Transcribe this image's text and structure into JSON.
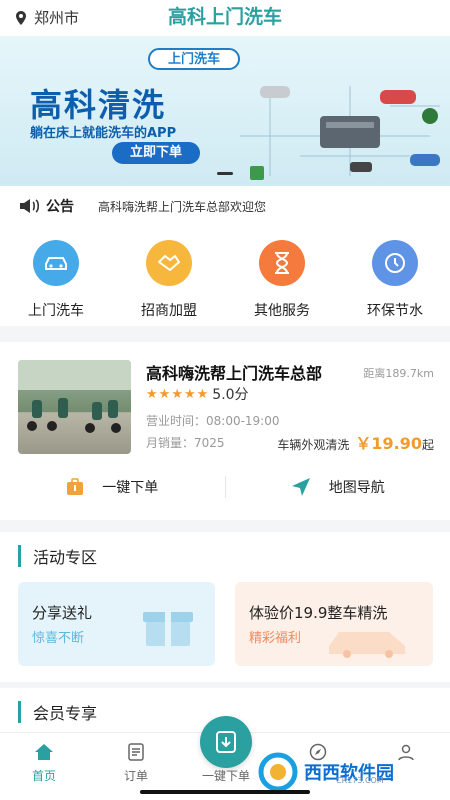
{
  "header": {
    "city": "郑州市",
    "title": "高科上门洗车"
  },
  "banner": {
    "pill": "上门洗车",
    "title": "高科清洗",
    "subtitle": "躺在床上就能洗车的APP",
    "button": "立即下单"
  },
  "notice": {
    "label": "公告",
    "text": "高科嗨洗帮上门洗车总部欢迎您"
  },
  "nav": [
    {
      "label": "上门洗车",
      "icon": "car-icon",
      "color": "#46a9e8"
    },
    {
      "label": "招商加盟",
      "icon": "handshake-icon",
      "color": "#f6b73c"
    },
    {
      "label": "其他服务",
      "icon": "hourglass-icon",
      "color": "#f57a3d"
    },
    {
      "label": "环保节水",
      "icon": "clock-icon",
      "color": "#5e93e6"
    }
  ],
  "shop": {
    "name": "高科嗨洗帮上门洗车总部",
    "distance": "距离189.7km",
    "rating": "5.0分",
    "hours": "营业时间：08:00-19:00",
    "sales": "月销量：7025",
    "service_name": "车辆外观清洗",
    "price": "￥19.90",
    "price_suffix": "起",
    "order_label": "一键下单",
    "nav_label": "地图导航"
  },
  "activity": {
    "title": "活动专区",
    "promos": [
      {
        "title": "分享送礼",
        "subtitle": "惊喜不断",
        "color": "#5fb6dd"
      },
      {
        "title": "体验价19.9整车精洗",
        "subtitle": "精彩福利",
        "color": "#f08a5a"
      }
    ]
  },
  "member": {
    "title": "会员专享"
  },
  "tabbar": {
    "home": "首页",
    "orders": "订单",
    "order_now": "一键下单"
  },
  "watermark": {
    "text": "西西软件园",
    "sub": "CR173.COM"
  },
  "colors": {
    "accent": "#2aa0a0",
    "price": "#f29a2e"
  }
}
